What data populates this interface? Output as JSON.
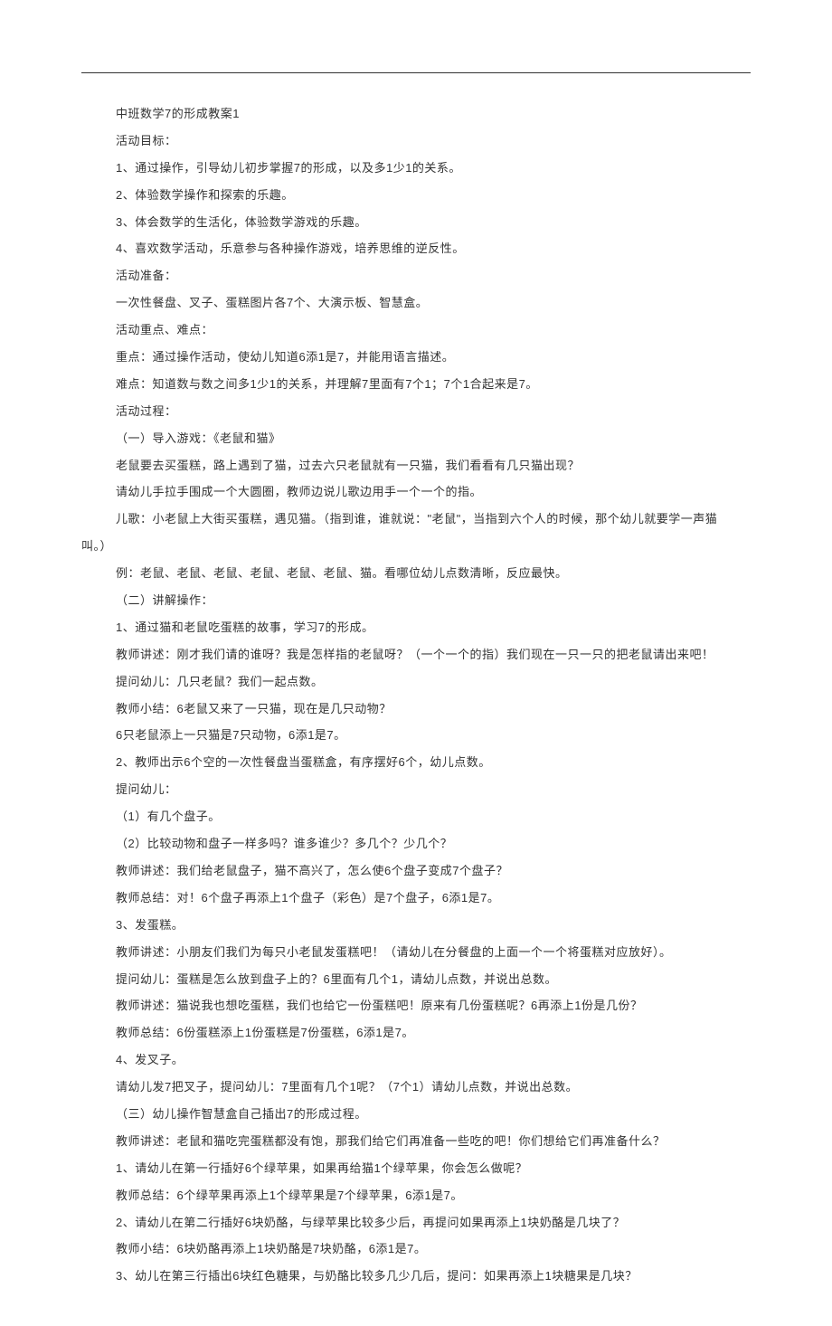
{
  "title": "中班数学7的形成教案1",
  "section_goals_header": "活动目标：",
  "goals": [
    "1、通过操作，引导幼儿初步掌握7的形成，以及多1少1的关系。",
    "2、体验数学操作和探索的乐趣。",
    "3、体会数学的生活化，体验数学游戏的乐趣。",
    "4、喜欢数学活动，乐意参与各种操作游戏，培养思维的逆反性。"
  ],
  "section_prep_header": "活动准备：",
  "prep": "一次性餐盘、叉子、蛋糕图片各7个、大演示板、智慧盒。",
  "section_focus_header": "活动重点、难点：",
  "focus": "重点：通过操作活动，使幼儿知道6添1是7，并能用语言描述。",
  "difficulty": "难点：知道数与数之间多1少1的关系，并理解7里面有7个1；7个1合起来是7。",
  "section_process_header": "活动过程：",
  "part1_header": "（一）导入游戏：《老鼠和猫》",
  "part1_lines": [
    "老鼠要去买蛋糕，路上遇到了猫，过去六只老鼠就有一只猫，我们看看有几只猫出现？",
    "请幼儿手拉手围成一个大圆圈，教师边说儿歌边用手一个一个的指。"
  ],
  "part1_rhyme_prefix": "儿歌：小老鼠上大街买蛋糕，遇见猫。（指到谁，谁就说：\"老鼠\"，当指到六个人的时候，那个幼儿就要学一声猫",
  "part1_rhyme_suffix": "叫。）",
  "part1_example": "例：老鼠、老鼠、老鼠、老鼠、老鼠、老鼠、猫。看哪位幼儿点数清晰，反应最快。",
  "part2_header": "（二）讲解操作：",
  "part2_1_header": "1、通过猫和老鼠吃蛋糕的故事，学习7的形成。",
  "part2_1_lines": [
    "教师讲述：刚才我们请的谁呀？我是怎样指的老鼠呀？（一个一个的指）我们现在一只一只的把老鼠请出来吧！",
    "提问幼儿：几只老鼠？我们一起点数。",
    "教师小结：6老鼠又来了一只猫，现在是几只动物？",
    "6只老鼠添上一只猫是7只动物，6添1是7。"
  ],
  "part2_2_header": "2、教师出示6个空的一次性餐盘当蛋糕盒，有序摆好6个，幼儿点数。",
  "part2_2_ask": "提问幼儿：",
  "part2_2_q1": "（1）有几个盘子。",
  "part2_2_q2": "（2）比较动物和盘子一样多吗？谁多谁少？多几个？少几个？",
  "part2_2_lines": [
    "教师讲述：我们给老鼠盘子，猫不高兴了，怎么使6个盘子变成7个盘子？",
    "教师总结：对！6个盘子再添上1个盘子（彩色）是7个盘子，6添1是7。"
  ],
  "part2_3_header": "3、发蛋糕。",
  "part2_3_lines": [
    "教师讲述：小朋友们我们为每只小老鼠发蛋糕吧！（请幼儿在分餐盘的上面一个一个将蛋糕对应放好）。",
    "提问幼儿：蛋糕是怎么放到盘子上的？6里面有几个1，请幼儿点数，并说出总数。",
    "教师讲述：猫说我也想吃蛋糕，我们也给它一份蛋糕吧！原来有几份蛋糕呢？6再添上1份是几份？",
    "教师总结：6份蛋糕添上1份蛋糕是7份蛋糕，6添1是7。"
  ],
  "part2_4_header": "4、发叉子。",
  "part2_4_line": "请幼儿发7把叉子，提问幼儿：7里面有几个1呢？（7个1）请幼儿点数，并说出总数。",
  "part3_header": "（三）幼儿操作智慧盒自己插出7的形成过程。",
  "part3_intro": "教师讲述：老鼠和猫吃完蛋糕都没有饱，那我们给它们再准备一些吃的吧！你们想给它们再准备什么？",
  "part3_items": [
    "1、请幼儿在第一行插好6个绿苹果，如果再给猫1个绿苹果，你会怎么做呢？",
    "教师总结：6个绿苹果再添上1个绿苹果是7个绿苹果，6添1是7。",
    "2、请幼儿在第二行插好6块奶酪，与绿苹果比较多少后，再提问如果再添上1块奶酪是几块了？",
    "教师小结：6块奶酪再添上1块奶酪是7块奶酪，6添1是7。",
    "3、幼儿在第三行插出6块红色糖果，与奶酪比较多几少几后，提问：如果再添上1块糖果是几块？"
  ]
}
